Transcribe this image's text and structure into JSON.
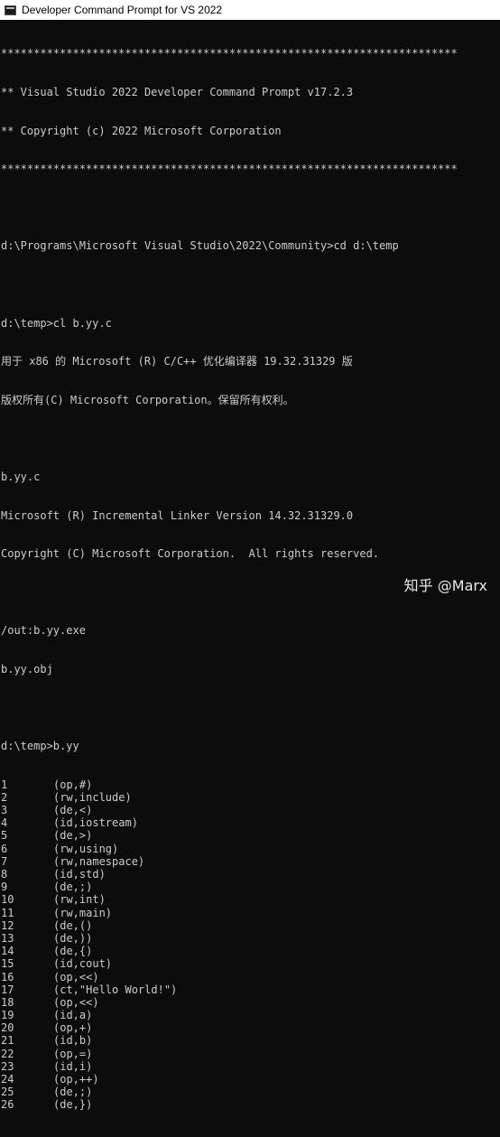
{
  "window": {
    "title": "Developer Command Prompt for VS 2022"
  },
  "console": {
    "header": [
      "**********************************************************************",
      "** Visual Studio 2022 Developer Command Prompt v17.2.3",
      "** Copyright (c) 2022 Microsoft Corporation",
      "**********************************************************************"
    ],
    "cmd_cd": "d:\\Programs\\Microsoft Visual Studio\\2022\\Community>cd d:\\temp",
    "cmd_cl": "d:\\temp>cl b.yy.c",
    "compiler_banner": [
      "用于 x86 的 Microsoft (R) C/C++ 优化编译器 19.32.31329 版",
      "版权所有(C) Microsoft Corporation。保留所有权利。"
    ],
    "compile_file": "b.yy.c",
    "linker_banner": [
      "Microsoft (R) Incremental Linker Version 14.32.31329.0",
      "Copyright (C) Microsoft Corporation.  All rights reserved."
    ],
    "link_output": [
      "/out:b.yy.exe",
      "b.yy.obj"
    ],
    "cmd_run": "d:\\temp>b.yy",
    "tokens": [
      {
        "n": "1",
        "t": "(op,#)"
      },
      {
        "n": "2",
        "t": "(rw,include)"
      },
      {
        "n": "3",
        "t": "(de,<)"
      },
      {
        "n": "4",
        "t": "(id,iostream)"
      },
      {
        "n": "5",
        "t": "(de,>)"
      },
      {
        "n": "6",
        "t": "(rw,using)"
      },
      {
        "n": "7",
        "t": "(rw,namespace)"
      },
      {
        "n": "8",
        "t": "(id,std)"
      },
      {
        "n": "9",
        "t": "(de,;)"
      },
      {
        "n": "10",
        "t": "(rw,int)"
      },
      {
        "n": "11",
        "t": "(rw,main)"
      },
      {
        "n": "12",
        "t": "(de,()"
      },
      {
        "n": "13",
        "t": "(de,))"
      },
      {
        "n": "14",
        "t": "(de,{)"
      },
      {
        "n": "15",
        "t": "(id,cout)"
      },
      {
        "n": "16",
        "t": "(op,<<)"
      },
      {
        "n": "17",
        "t": "(ct,\"Hello World!\")"
      },
      {
        "n": "18",
        "t": "(op,<<)"
      },
      {
        "n": "19",
        "t": "(id,a)"
      },
      {
        "n": "20",
        "t": "(op,+)"
      },
      {
        "n": "21",
        "t": "(id,b)"
      },
      {
        "n": "22",
        "t": "(op,=)"
      },
      {
        "n": "23",
        "t": "(id,i)"
      },
      {
        "n": "24",
        "t": "(op,++)"
      },
      {
        "n": "25",
        "t": "(de,;)"
      },
      {
        "n": "26",
        "t": "(de,})"
      }
    ]
  },
  "watermark": "知乎 @Marx",
  "colors": {
    "console_bg": "#0c0c0c",
    "console_fg": "#cccccc",
    "titlebar_bg": "#ffffff"
  }
}
